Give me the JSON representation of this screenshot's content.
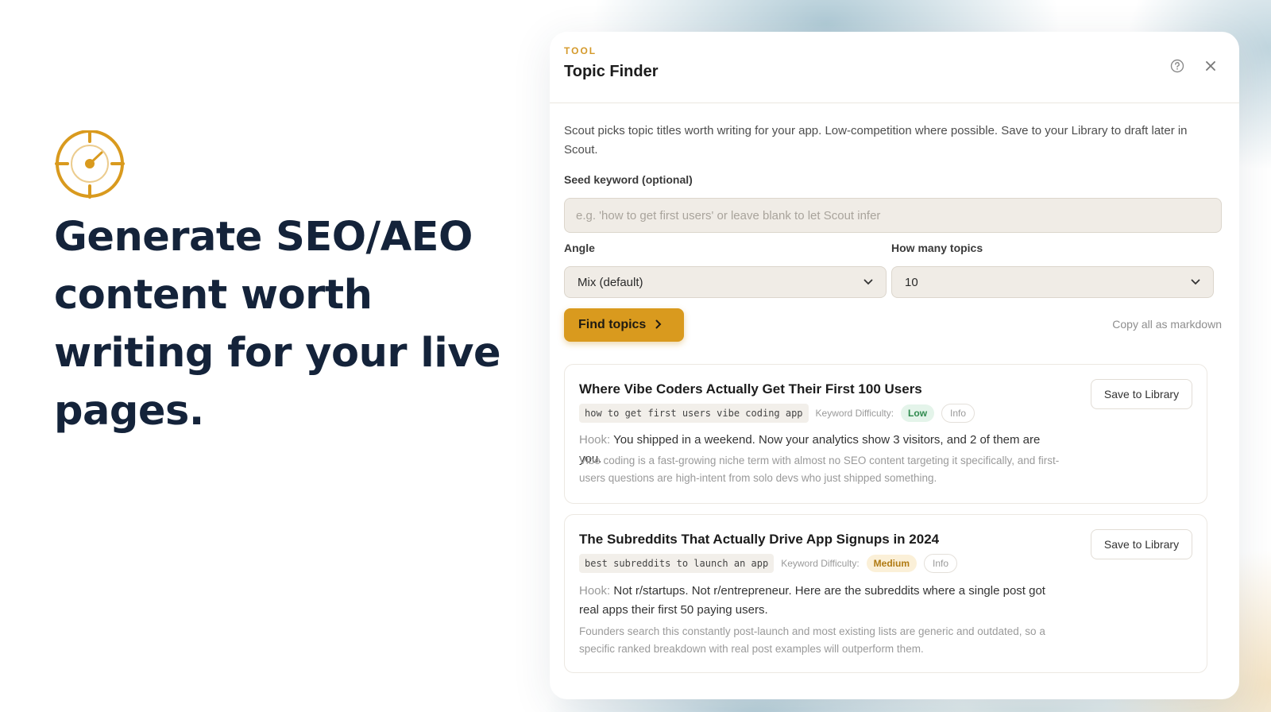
{
  "hero": {
    "icon": "target-icon",
    "title": "Generate SEO/AEO content worth writing for your live pages."
  },
  "colors": {
    "accent": "#d99a1e",
    "heading": "#14233a",
    "low": "#2f8a4e",
    "medium": "#b07a12"
  },
  "modal": {
    "eyebrow": "TOOL",
    "title": "Topic Finder",
    "help_icon": "help-circle-icon",
    "close_icon": "close-icon",
    "intro": "Scout picks topic titles worth writing for your app. Low-competition where possible. Save to your Library to draft later in Scout.",
    "seed": {
      "label": "Seed keyword (optional)",
      "value": "",
      "placeholder": "e.g. 'how to get first users' or leave blank to let Scout infer"
    },
    "angle": {
      "label": "Angle",
      "selected": "Mix (default)"
    },
    "count": {
      "label": "How many topics",
      "selected": "10"
    },
    "find_button": "Find topics",
    "copy_link": "Copy all as markdown",
    "results": [
      {
        "title": "Where Vibe Coders Actually Get Their First 100 Users",
        "keyword": "how to get first users vibe coding app",
        "difficulty_label": "Keyword Difficulty:",
        "difficulty": "Low",
        "info": "Info",
        "hook_label": "Hook:",
        "hook": "You shipped in a weekend. Now your analytics show 3 visitors, and 2 of them are you.",
        "description": "Vibe coding is a fast-growing niche term with almost no SEO content targeting it specifically, and first-users questions are high-intent from solo devs who just shipped something.",
        "save": "Save to Library"
      },
      {
        "title": "The Subreddits That Actually Drive App Signups in 2024",
        "keyword": "best subreddits to launch an app",
        "difficulty_label": "Keyword Difficulty:",
        "difficulty": "Medium",
        "info": "Info",
        "hook_label": "Hook:",
        "hook": "Not r/startups. Not r/entrepreneur. Here are the subreddits where a single post got real apps their first 50 paying users.",
        "description": "Founders search this constantly post-launch and most existing lists are generic and outdated, so a specific ranked breakdown with real post examples will outperform them.",
        "save": "Save to Library"
      }
    ]
  }
}
